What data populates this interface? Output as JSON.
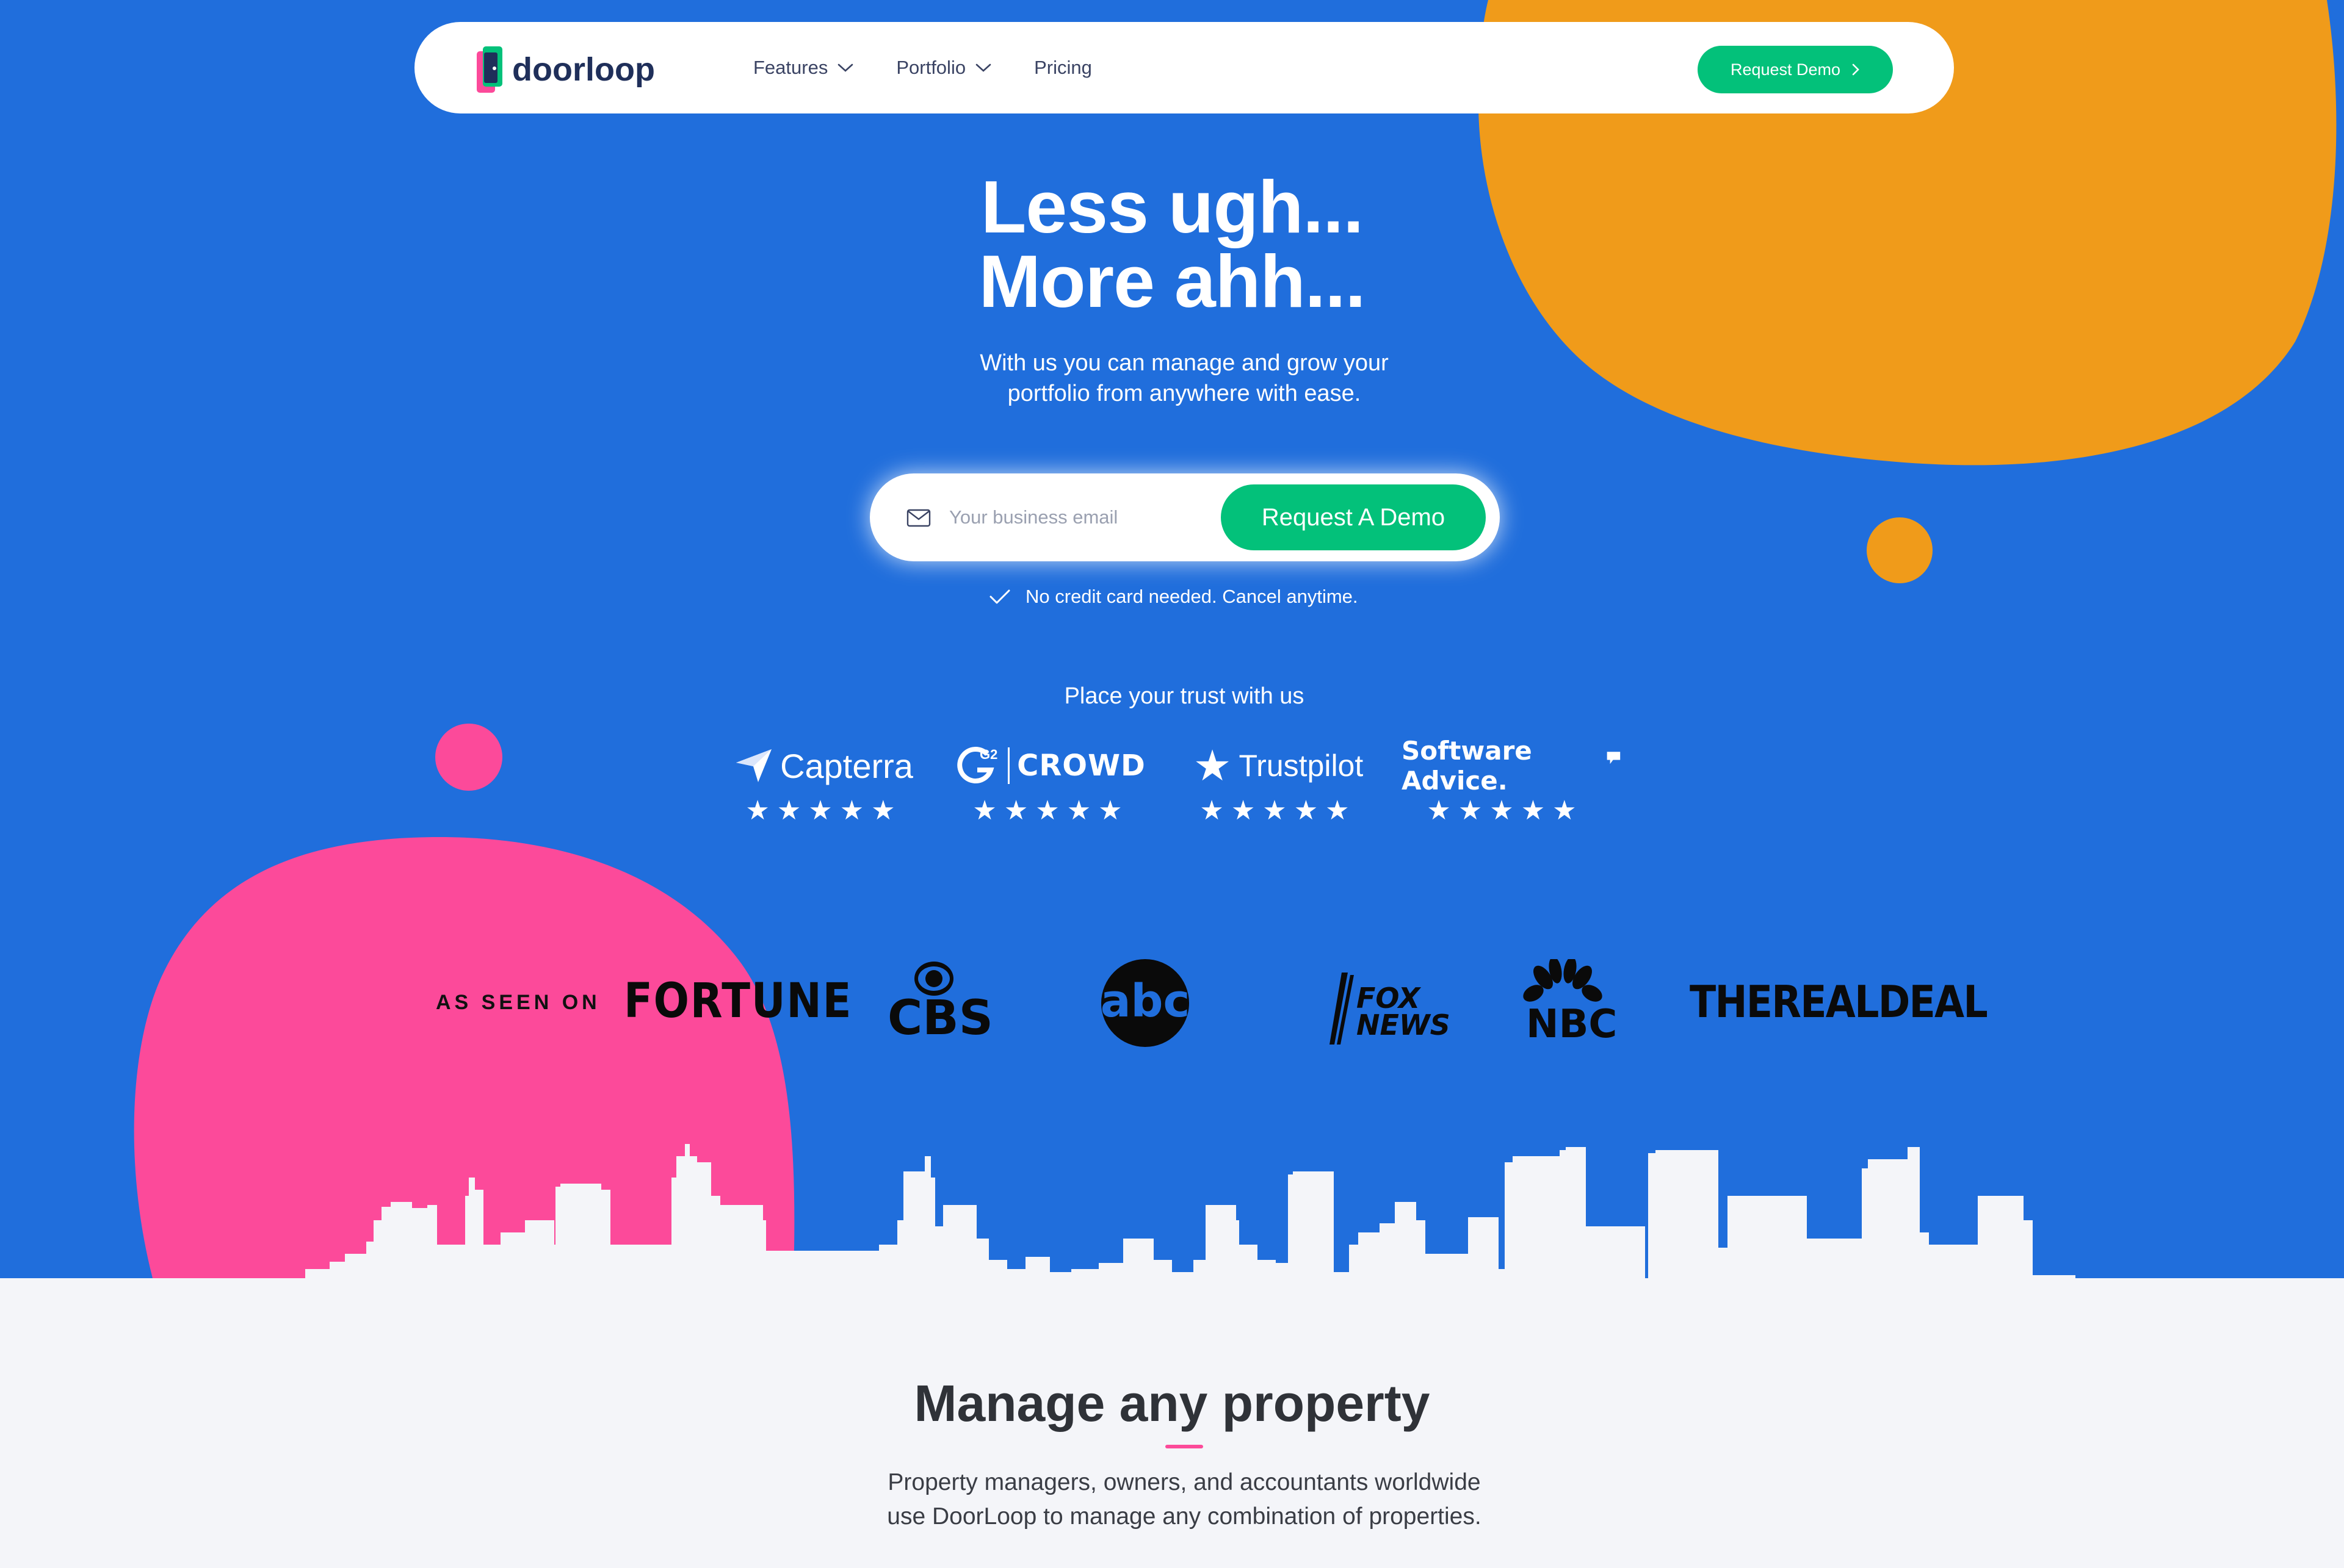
{
  "nav": {
    "logo_text": "doorloop",
    "links": [
      {
        "label": "Features",
        "has_dropdown": true
      },
      {
        "label": "Portfolio",
        "has_dropdown": true
      },
      {
        "label": "Pricing",
        "has_dropdown": false
      }
    ],
    "cta_label": "Request Demo"
  },
  "hero": {
    "headline_line1": "Less ugh...",
    "headline_line2": "More ahh...",
    "subhead_line1": "With us you can manage and grow your",
    "subhead_line2": "portfolio from anywhere with ease.",
    "email_placeholder": "Your business email",
    "email_value": "",
    "submit_label": "Request A Demo",
    "note": "No credit card needed. Cancel anytime."
  },
  "trust": {
    "title": "Place your trust with us",
    "brands": [
      {
        "name": "Capterra",
        "rating": 5,
        "stars": "★★★★★"
      },
      {
        "name": "CROWD",
        "prefix": "G2",
        "rating": 5,
        "stars": "★★★★★"
      },
      {
        "name": "Trustpilot",
        "rating": 5,
        "stars": "★★★★★"
      },
      {
        "name": "Software Advice.",
        "rating": 5,
        "stars": "★★★★★"
      }
    ]
  },
  "as_seen_on": {
    "label": "AS SEEN ON",
    "outlets": [
      "FORTUNE",
      "CBS",
      "abc",
      "FOX NEWS",
      "NBC",
      "THEREALDEAL"
    ]
  },
  "section": {
    "title": "Manage any property",
    "body_line1": "Property managers, owners, and accountants worldwide",
    "body_line2": "use DoorLoop to manage any combination of properties."
  },
  "colors": {
    "hero_blue": "#206edc",
    "orange": "#f09b1a",
    "pink": "#fc4a9a",
    "green": "#03c17a",
    "navy": "#1f2f5a",
    "page_bg": "#f4f5f9"
  }
}
